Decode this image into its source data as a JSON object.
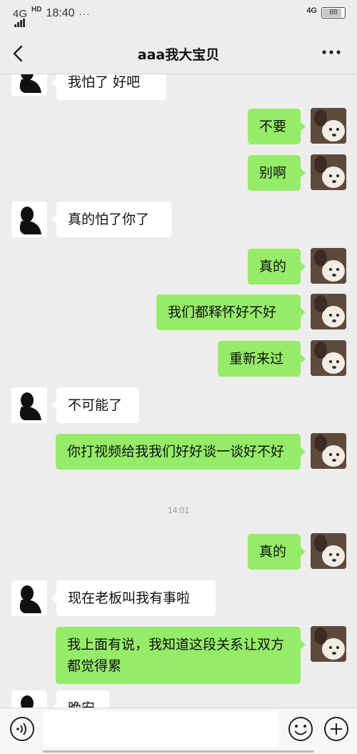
{
  "status_bar": {
    "network_left": "4G",
    "hd_label": "HD",
    "time": "18:40",
    "dots": "···",
    "network_right": "4G",
    "battery_level": 0.88,
    "battery_text": "88"
  },
  "nav": {
    "title": "aaa我大宝贝",
    "back_icon": "chevron-left-icon",
    "more_icon": "more-dots-icon"
  },
  "messages": [
    {
      "side": "left",
      "text": "我怕了 好吧"
    },
    {
      "side": "right",
      "text": "不要"
    },
    {
      "side": "right",
      "text": "别啊"
    },
    {
      "side": "left",
      "text": "真的怕了你了"
    },
    {
      "side": "right",
      "text": "真的"
    },
    {
      "side": "right",
      "text": "我们都释怀好不好"
    },
    {
      "side": "right",
      "text": "重新来过"
    },
    {
      "side": "left",
      "text": "不可能了"
    },
    {
      "side": "right",
      "text": "你打视频给我我们好好谈一谈好不好"
    },
    {
      "side": "right",
      "text": "真的"
    },
    {
      "side": "left",
      "text": "现在老板叫我有事啦"
    },
    {
      "side": "right",
      "text": "我上面有说，我知道这段关系让双方都觉得累"
    },
    {
      "side": "left",
      "text": "晚安"
    }
  ],
  "timestamp": "14:01",
  "colors": {
    "background": "#ededed",
    "bubble_right": "#95ec69",
    "bubble_left": "#ffffff"
  },
  "input_bar": {
    "voice_icon": "voice-icon",
    "emoji_icon": "emoji-icon",
    "plus_icon": "plus-icon",
    "placeholder": ""
  }
}
